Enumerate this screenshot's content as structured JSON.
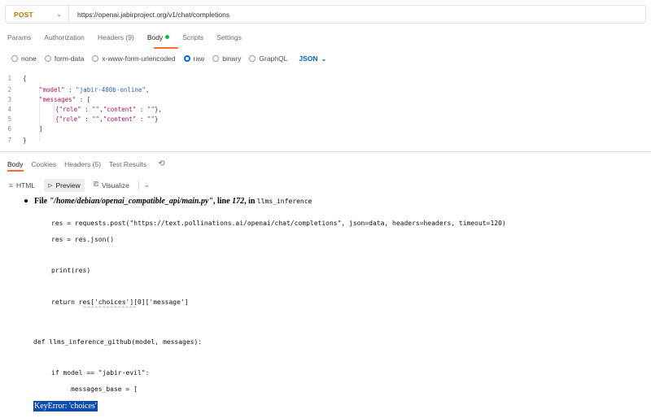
{
  "request": {
    "method": "POST",
    "url": "https://openai.jabirproject.org/v1/chat/completions"
  },
  "request_tabs": [
    {
      "label": "Params"
    },
    {
      "label": "Authorization"
    },
    {
      "label": "Headers (9)"
    },
    {
      "label": "Body"
    },
    {
      "label": "Scripts"
    },
    {
      "label": "Settings"
    }
  ],
  "body_types": {
    "none": "none",
    "form_data": "form-data",
    "urlencoded": "x-www-form-urlencoded",
    "raw": "raw",
    "binary": "binary",
    "graphql": "GraphQL",
    "format": "JSON",
    "selected": "raw"
  },
  "editor": {
    "line_numbers": [
      "1",
      "2",
      "3",
      "4",
      "5",
      "6",
      "7"
    ],
    "open_brace": "{",
    "model_key": "\"model\"",
    "model_value": "\"jabir-400b-online\"",
    "messages_key": "\"messages\"",
    "msg_role_key": "{\"role\"",
    "msg_content_key": "\"content\"",
    "empty_str": "\"\"",
    "close_bracket": "]",
    "close_brace": "}"
  },
  "response_tabs": [
    {
      "label": "Body"
    },
    {
      "label": "Cookies"
    },
    {
      "label": "Headers (5)"
    },
    {
      "label": "Test Results"
    }
  ],
  "view_toolbar": {
    "html": "HTML",
    "preview": "Preview",
    "visualize": "Visualize"
  },
  "preview": {
    "file_prefix": "File",
    "file_path": "\"/home/debian/openai_compatible_api/main.py\"",
    "line_text": ", line",
    "line_no": "172",
    "in_text": ", in",
    "func": "llms_inference",
    "code_lines": [
      "res = requests.post(\"https://text.pollinations.ai/openai/chat/completions\", json=data, headers=headers, timeout=120)",
      "res = res.json()",
      "print(res)",
      "return res['choices'][0]['message']",
      "def llms_inference_github(model, messages):",
      "if model == \"jabir-evil\":",
      "messages_base = ["
    ],
    "carets": "^^^^^^^^^^^^^^",
    "error": "KeyError: 'choices'"
  },
  "colors": {
    "method": "#b77800",
    "accent": "#ff6c37",
    "selected_blue": "#0265d2",
    "status_green": "#0cbb52",
    "error_highlight": "#0c4bb0"
  },
  "icons": [
    "chevron-down-icon",
    "radio-icon",
    "history-icon",
    "html-icon",
    "play-icon",
    "visualize-icon"
  ]
}
